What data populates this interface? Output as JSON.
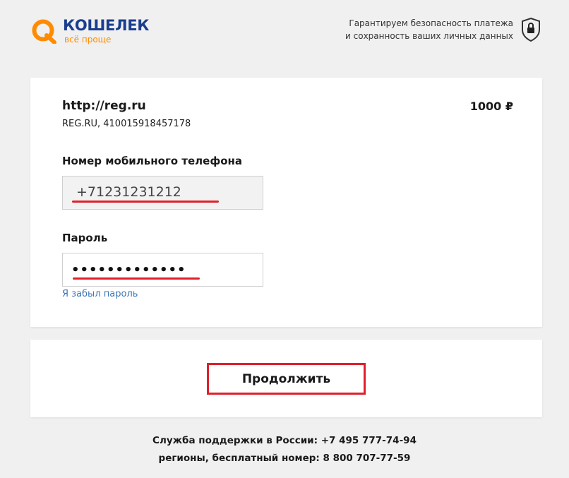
{
  "header": {
    "logo_title": "КОШЕЛЕК",
    "logo_subtitle": "всё проще",
    "security_line1": "Гарантируем безопасность платежа",
    "security_line2": "и сохранность ваших личных данных",
    "security_icon": "shield-lock-icon"
  },
  "payment": {
    "merchant_name": "http://reg.ru",
    "merchant_detail": "REG.RU, 410015918457178",
    "amount": "1000 ₽"
  },
  "form": {
    "phone_label": "Номер мобильного телефона",
    "phone_value": "+71231231212",
    "password_label": "Пароль",
    "password_value": "•••••••••••••",
    "forgot_link": "Я забыл пароль"
  },
  "actions": {
    "continue_label": "Продолжить"
  },
  "support": {
    "line1": "Служба поддержки в России: +7 495 777-74-94",
    "line2": "регионы, бесплатный номер: 8 800 707-77-59"
  },
  "colors": {
    "brand_orange": "#ff8c00",
    "brand_blue": "#1a3d8f",
    "highlight_red": "#e0202a",
    "link_blue": "#3e76b5",
    "background": "#f0f0f0"
  }
}
